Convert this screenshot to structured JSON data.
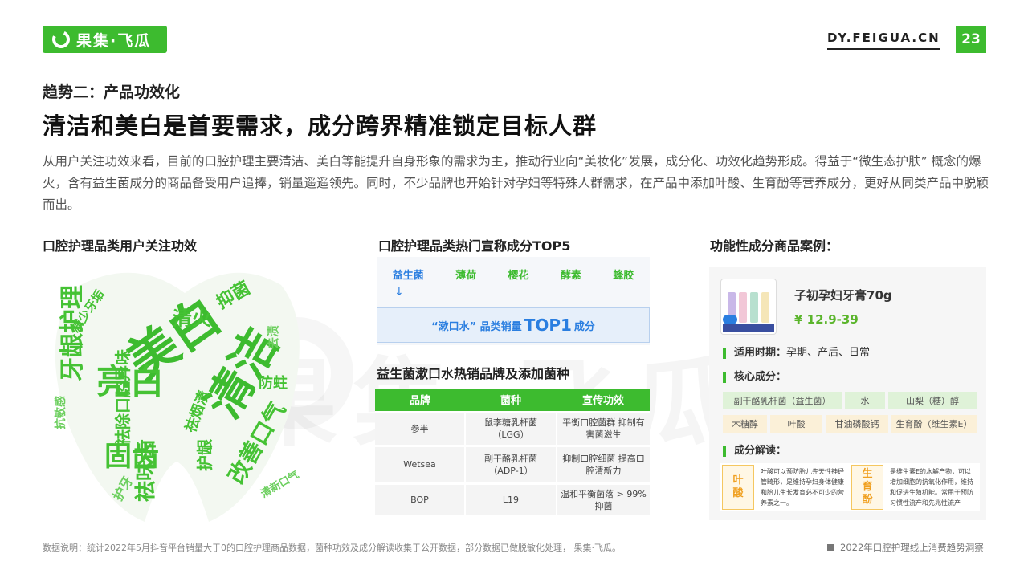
{
  "header": {
    "logo_text": "果集·飞瓜",
    "site": "DY.FEIGUA.CN",
    "page_number": "23"
  },
  "subtitle": "趋势二：产品功效化",
  "title": "清洁和美白是首要需求，成分跨界精准锁定目标人群",
  "intro": "从用户关注功效来看，目前的口腔护理主要清洁、美白等能提升自身形象的需求为主，推动行业向“美妆化”发展，成分化、功效化趋势形成。得益于“微生态护肤” 概念的爆火，含有益生菌成分的商品备受用户追捧，销量遥遥领先。同时，不少品牌也开始针对孕妇等特殊人群需求，在产品中添加叶酸、生育酚等营养成分，更好从同类产品中脱颖而出。",
  "watermark": "果集·飞瓜",
  "wordcloud": {
    "title": "口腔护理品类用户关注功效",
    "words": [
      "美白",
      "清洁",
      "牙龈护理",
      "清火",
      "防蛀",
      "固齿",
      "抑菌",
      "亮白",
      "祛除口腔异味",
      "祛味齿",
      "改善口气",
      "减少牙垢",
      "抗敏感",
      "祛烟渍",
      "清新口气",
      "护龈",
      "去渍",
      "护牙"
    ]
  },
  "top5": {
    "title": "口腔护理品类热门宣称成分TOP5",
    "items": [
      "益生菌",
      "薄荷",
      "樱花",
      "酵素",
      "蜂胶"
    ],
    "arrow": "↓",
    "highlight_pre": "“漱口水” 品类销量",
    "highlight_big": "TOP1",
    "highlight_post": "成分"
  },
  "brands": {
    "title": "益生菌漱口水热销品牌及添加菌种",
    "headers": [
      "品牌",
      "菌种",
      "宣传功效"
    ],
    "rows": [
      {
        "brand": "参半",
        "strain": "鼠李糖乳杆菌（LGG）",
        "effect": "平衡口腔菌群 抑制有害菌滋生"
      },
      {
        "brand": "Wetsea",
        "strain": "副干酪乳杆菌 （ADP-1）",
        "effect": "抑制口腔细菌 提高口腔清新力"
      },
      {
        "brand": "BOP",
        "strain": "L19",
        "effect": "温和平衡菌落 > 99%抑菌"
      }
    ]
  },
  "case": {
    "title": "功能性成分商品案例：",
    "product_name": "子初孕妇牙膏70g",
    "price": "¥ 12.9-39",
    "period_label": "适用时期：",
    "period_value": "孕期、产后、日常",
    "core_label": "核心成分：",
    "ingredients_row1": [
      "副干酪乳杆菌（益生菌）",
      "水",
      "山梨（糖）醇"
    ],
    "ingredients_row2": [
      "木糖醇",
      "叶酸",
      "甘油磷酸钙",
      "生育酚（维生素E）"
    ],
    "interp_label": "成分解读：",
    "interp": [
      {
        "key": "叶酸",
        "text": "叶酸可以预防胎儿先天性神经管畸形，是维持孕妇身体健康和胎儿生长发育必不可少的营养素之一。"
      },
      {
        "key": "生育酚",
        "text": "是维生素E的水解产物，可以增加细胞的抗氧化作用，维持和促进生殖机能。常用于预防习惯性流产和先兆性流产"
      }
    ]
  },
  "footer": {
    "note": "数据说明：统计2022年5月抖音平台销量大于0的口腔护理商品数据，菌种功效及成分解读收集于公开数据，部分数据已做脱敏化处理， 果集·飞瓜。",
    "report": "2022年口腔护理线上消费趋势洞察"
  },
  "colors": {
    "brand_green": "#3dbb2f",
    "blue": "#2a7ee0",
    "price_green": "#5bb52c",
    "orange": "#f0a020"
  }
}
